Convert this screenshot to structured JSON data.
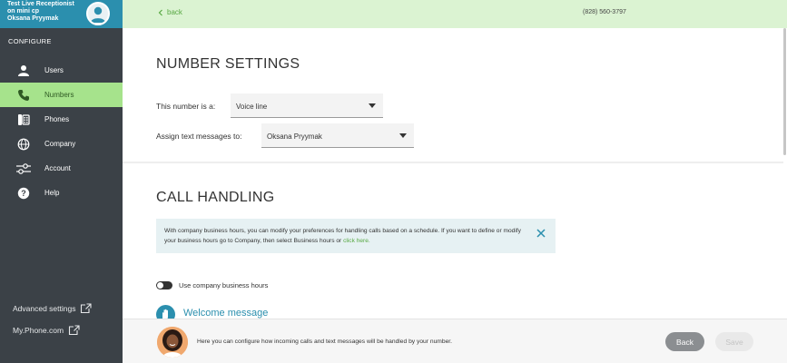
{
  "sidebar": {
    "account": {
      "line1": "Test Live Receptionist",
      "line2": "on mini cp",
      "line3": "Oksana Pryymak"
    },
    "configure_label": "CONFIGURE",
    "items": [
      {
        "label": "Users",
        "icon": "user-icon",
        "active": false
      },
      {
        "label": "Numbers",
        "icon": "phone-handset-icon",
        "active": true
      },
      {
        "label": "Phones",
        "icon": "desk-phone-icon",
        "active": false
      },
      {
        "label": "Company",
        "icon": "globe-icon",
        "active": false
      },
      {
        "label": "Account",
        "icon": "sliders-icon",
        "active": false
      },
      {
        "label": "Help",
        "icon": "help-icon",
        "active": false
      }
    ],
    "advanced_settings": "Advanced settings",
    "my_phone": "My.Phone.com"
  },
  "topbar": {
    "back_label": "back",
    "phone_number": "(828) 560-3797"
  },
  "number_settings": {
    "title": "NUMBER SETTINGS",
    "number_type_label": "This number is a:",
    "number_type_value": "Voice line",
    "assign_label": "Assign text messages to:",
    "assign_value": "Oksana Pryymak"
  },
  "call_handling": {
    "title": "CALL HANDLING",
    "info_text": "With company business hours, you can modify your preferences for handling calls based on a schedule. If you want to define or modify your business hours go to Company, then select Business hours or ",
    "info_link": "click here.",
    "toggle_label": "Use company business hours",
    "toggle_on": false,
    "welcome_label": "Welcome message"
  },
  "footer": {
    "text": "Here you can configure how incoming calls and text messages will be handled by your number.",
    "back_button": "Back",
    "save_button": "Save"
  },
  "colors": {
    "sidebar_bg": "#3b4147",
    "account_bg": "#2b8fae",
    "active_nav": "#a6e38c",
    "topbar_bg": "#dbf3d2",
    "accent_green": "#58a843",
    "accent_blue": "#2b8fae"
  }
}
